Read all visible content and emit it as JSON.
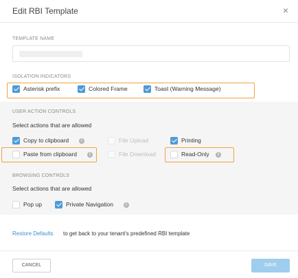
{
  "dialog": {
    "title": "Edit RBI Template",
    "close_icon": "×"
  },
  "template_name": {
    "label": "TEMPLATE NAME",
    "value": ""
  },
  "isolation": {
    "label": "ISOLATION INDICATORS",
    "options": [
      {
        "label": "Asterisk prefix",
        "checked": true
      },
      {
        "label": "Colored Frame",
        "checked": true
      },
      {
        "label": "Toast (Warning Message)",
        "checked": true
      }
    ]
  },
  "user_actions": {
    "label": "USER ACTION CONTROLS",
    "hint": "Select actions that are allowed",
    "options": [
      {
        "label": "Copy to clipboard",
        "checked": true,
        "enabled": true,
        "info": true
      },
      {
        "label": "File Upload",
        "checked": false,
        "enabled": false
      },
      {
        "label": "Printing",
        "checked": true,
        "enabled": true
      },
      {
        "label": "Paste from clipboard",
        "checked": false,
        "enabled": true,
        "info": true
      },
      {
        "label": "File Download",
        "checked": false,
        "enabled": false
      },
      {
        "label": "Read-Only",
        "checked": false,
        "enabled": true,
        "info": true
      }
    ]
  },
  "browsing": {
    "label": "BROWSING CONTROLS",
    "hint": "Select actions that are allowed",
    "options": [
      {
        "label": "Pop up",
        "checked": false
      },
      {
        "label": "Private Navigation",
        "checked": true,
        "info": true
      }
    ]
  },
  "restore": {
    "link": "Restore Defaults",
    "text": "to get back to your tenant's predefined RBI template"
  },
  "buttons": {
    "cancel": "CANCEL",
    "save": "SAVE"
  },
  "colors": {
    "accent": "#4d9bd8",
    "highlight": "#f0a340",
    "link": "#3b8fd1",
    "save_disabled": "#9fcdee"
  }
}
